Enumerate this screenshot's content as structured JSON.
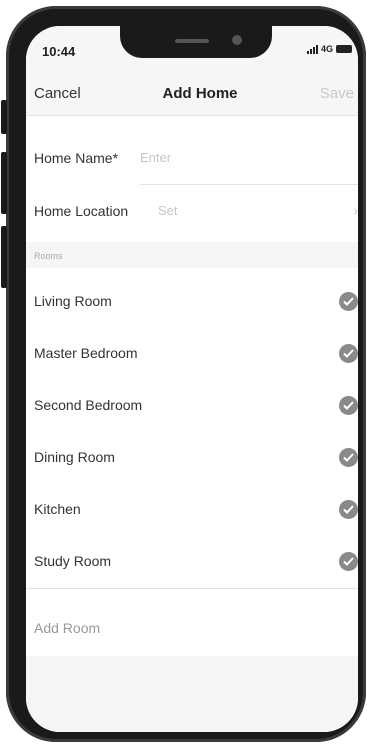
{
  "status": {
    "time": "10:44",
    "network": "4G"
  },
  "nav": {
    "cancel": "Cancel",
    "title": "Add Home",
    "save": "Save"
  },
  "form": {
    "name_label": "Home Name*",
    "name_placeholder": "Enter",
    "location_label": "Home Location",
    "location_value": "Set",
    "chevron": "›"
  },
  "rooms_header": "Rooms",
  "rooms": [
    {
      "label": "Living Room",
      "checked": true
    },
    {
      "label": "Master Bedroom",
      "checked": true
    },
    {
      "label": "Second Bedroom",
      "checked": true
    },
    {
      "label": "Dining Room",
      "checked": true
    },
    {
      "label": "Kitchen",
      "checked": true
    },
    {
      "label": "Study Room",
      "checked": true
    }
  ],
  "add_room": "Add Room",
  "colors": {
    "check": "#8a8a8a",
    "disabled_text": "#c8c8c8",
    "background": "#f5f5f5"
  }
}
